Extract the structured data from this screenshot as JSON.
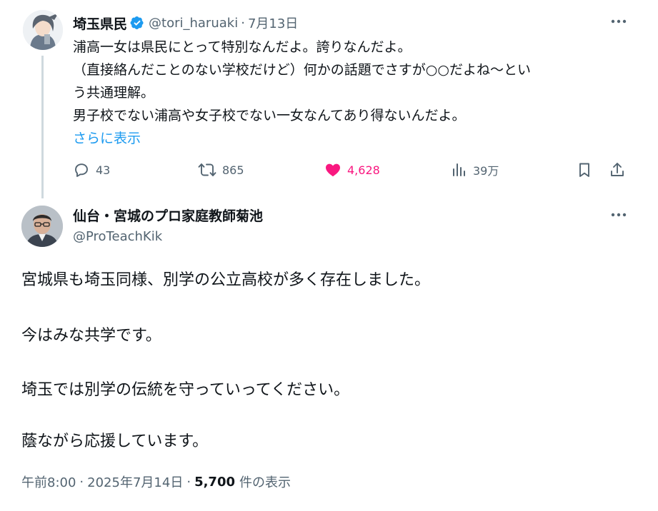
{
  "parent": {
    "display_name": "埼玉県民",
    "handle": "@tori_haruaki",
    "separator": "·",
    "date": "7月13日",
    "lines": [
      "浦高一女は県民にとって特別なんだよ。誇りなんだよ。",
      "（直接絡んだことのない学校だけど）何かの話題でさすが○○だよね〜とい",
      "う共通理解。",
      "男子校でない浦高や女子校でない一女なんてあり得ないんだよ。"
    ],
    "show_more": "さらに表示",
    "actions": {
      "replies": "43",
      "reposts": "865",
      "likes": "4,628",
      "views": "39万"
    },
    "colors": {
      "like": "#f91880",
      "link": "#1d9bf0",
      "verified": "#1d9bf0"
    }
  },
  "reply": {
    "display_name": "仙台・宮城のプロ家庭教師菊池",
    "handle": "@ProTeachKik",
    "paragraphs": [
      "宮城県も埼玉同様、別学の公立高校が多く存在しました。",
      "今はみな共学です。",
      "埼玉では別学の伝統を守っていってください。",
      "蔭ながら応援しています。"
    ],
    "meta": {
      "time": "午前8:00",
      "sep": "·",
      "date": "2025年7月14日",
      "views_count": "5,700",
      "views_label": "件の表示"
    }
  },
  "icons": [
    "verified-badge-icon",
    "more-icon",
    "reply-icon",
    "repost-icon",
    "like-icon",
    "analytics-icon",
    "bookmark-icon",
    "share-icon"
  ]
}
